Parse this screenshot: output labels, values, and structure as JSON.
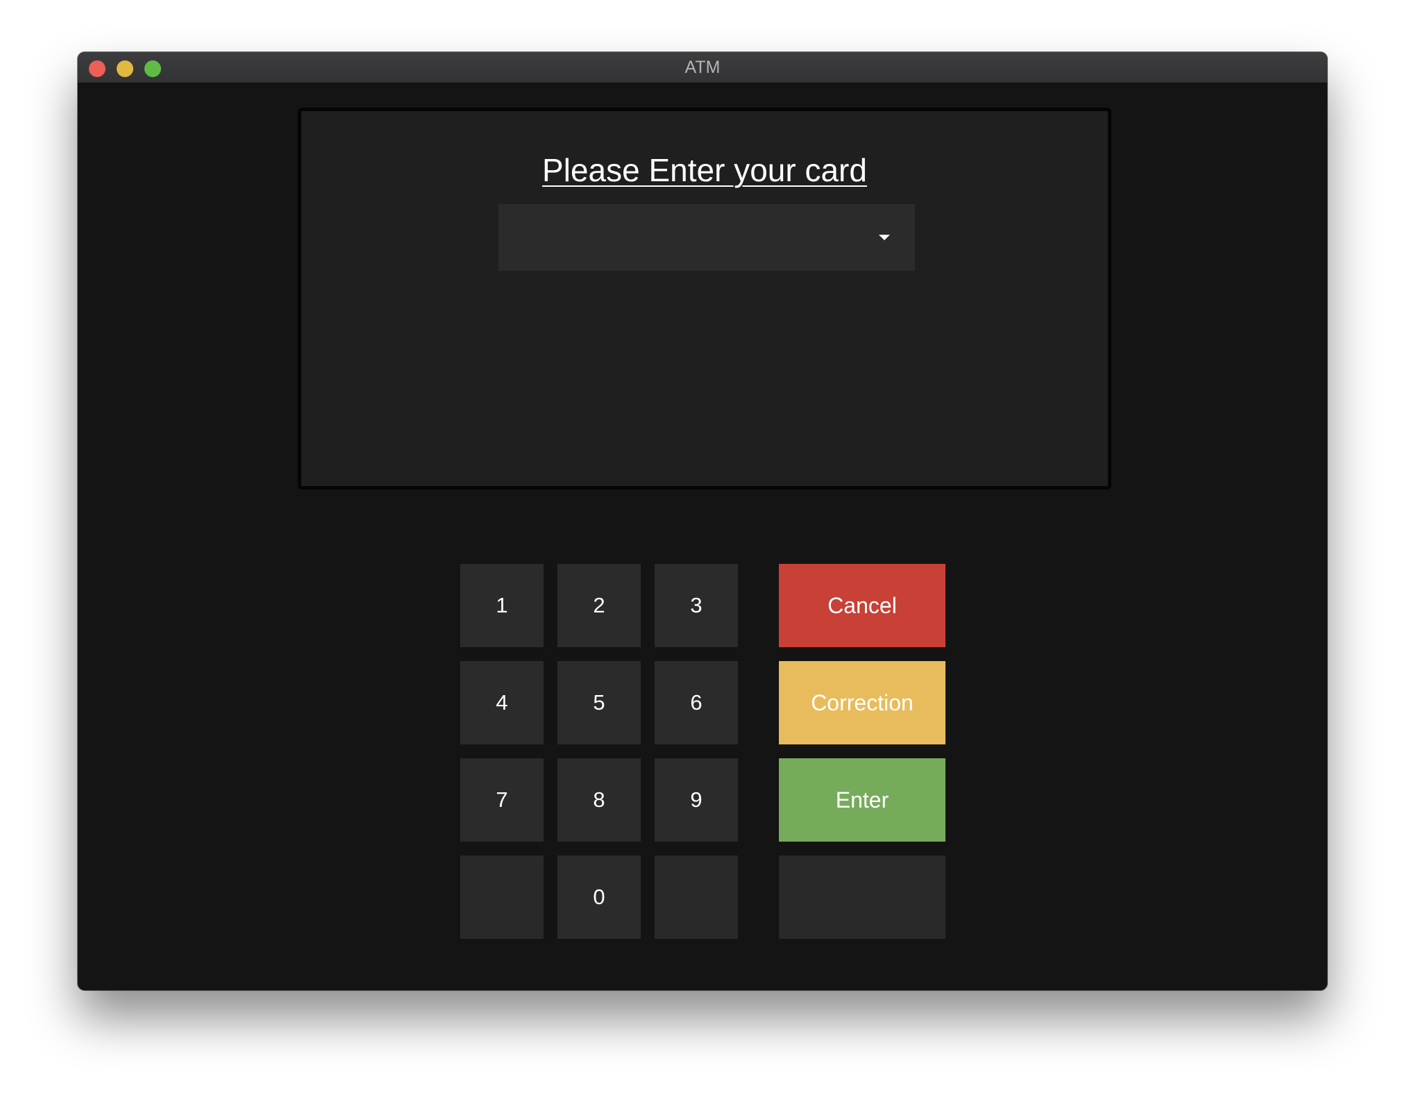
{
  "window": {
    "title": "ATM"
  },
  "screen": {
    "prompt": "Please Enter your card",
    "card_select": {
      "selected": ""
    }
  },
  "keypad": {
    "digits": [
      "1",
      "2",
      "3",
      "4",
      "5",
      "6",
      "7",
      "8",
      "9",
      "0"
    ]
  },
  "function_keys": {
    "cancel": "Cancel",
    "correction": "Correction",
    "enter": "Enter"
  },
  "colors": {
    "cancel": "#c94037",
    "correction": "#e8bc5c",
    "enter": "#77ab5c",
    "key": "#2b2b2b"
  }
}
